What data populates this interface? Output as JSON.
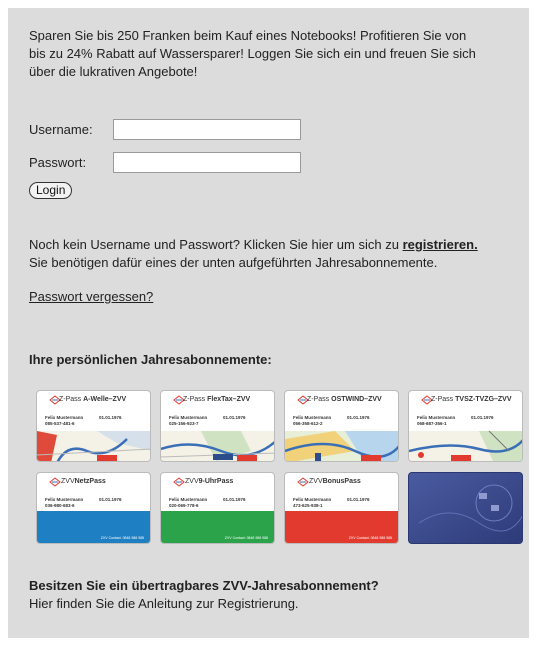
{
  "promo": {
    "line1": "Sparen Sie bis 250 Franken beim Kauf eines Notebooks! Profitieren Sie von",
    "line2": "bis zu 24% Rabatt auf Wassersparer! Loggen Sie sich ein und freuen Sie sich",
    "line3": "über die lukrativen Angebote!"
  },
  "login": {
    "username_label": "Username:",
    "username_value": "",
    "password_label": "Passwort:",
    "password_value": "",
    "button_label": "Login"
  },
  "register": {
    "text_before": "Noch kein Username und Passwort? Klicken Sie hier um sich zu ",
    "link": "registrieren.",
    "line2": "Sie benötigen dafür eines der unten aufgeführten Jahresabonnemente."
  },
  "forgot_password": "Passwort vergessen?",
  "subscriptions": {
    "heading": "Ihre persönlichen Jahresabonnemente:",
    "cards": [
      {
        "prefix": "Z-Pass",
        "name": "A-Welle–ZVV",
        "holder": "Felix Mustermann",
        "date": "01.01.1976",
        "number": "085-537-481-6",
        "color": "#3a6fb8"
      },
      {
        "prefix": "Z-Pass",
        "name": "FlexTax–ZVV",
        "holder": "Felix Mustermann",
        "date": "01.01.1976",
        "number": "025-156-923-7",
        "color": "#3a6fb8"
      },
      {
        "prefix": "Z-Pass",
        "name": "OSTWIND–ZVV",
        "holder": "Felix Mustermann",
        "date": "01.01.1976",
        "number": "056-358-612-2",
        "color": "#3a6fb8"
      },
      {
        "prefix": "Z-Pass",
        "name": "TVSZ-TVZG–ZVV",
        "holder": "Felix Mustermann",
        "date": "01.01.1976",
        "number": "068-687-356-1",
        "color": "#3a6fb8"
      },
      {
        "prefix": "ZVV",
        "name": "NetzPass",
        "holder": "Felix Mustermann",
        "date": "01.01.1976",
        "number": "036-980-683-6",
        "color": "#1f7fc3",
        "footer": "ZVV Contact: 0848 988 988"
      },
      {
        "prefix": "ZVV",
        "name": "9-UhrPass",
        "holder": "Felix Mustermann",
        "date": "01.01.1976",
        "number": "020-069-778-6",
        "color": "#2aa34a",
        "footer": "ZVV Contact: 0848 988 988"
      },
      {
        "prefix": "ZVV",
        "name": "BonusPass",
        "holder": "Felix Mustermann",
        "date": "01.01.1976",
        "number": "473-625-938-1",
        "color": "#e23a2e",
        "footer": "ZVV Contact: 0848 988 988"
      },
      {
        "prefix": "",
        "name": "",
        "holder": "",
        "date": "",
        "number": "",
        "color": "#3a4a8a"
      }
    ]
  },
  "transfer": {
    "heading": "Besitzen Sie ein übertragbares ZVV-Jahresabonnement?",
    "text": "Hier finden Sie die Anleitung zur Registrierung."
  }
}
